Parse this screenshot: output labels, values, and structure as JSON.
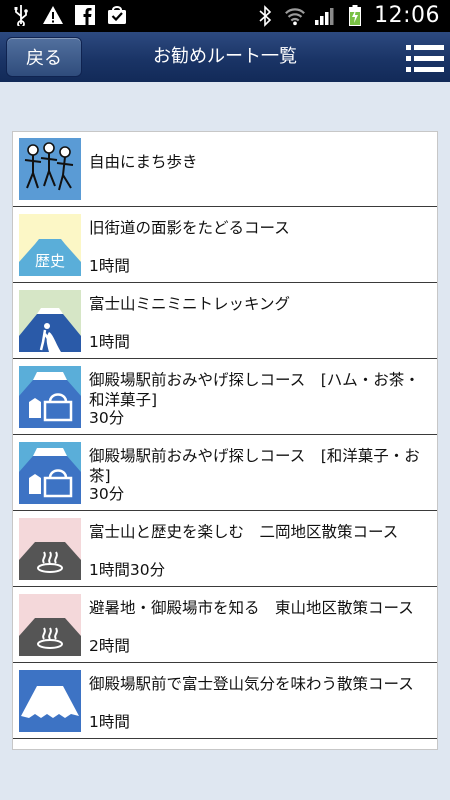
{
  "status_bar": {
    "time": "12:06",
    "icons": [
      "usb-icon",
      "warning-icon",
      "facebook-icon",
      "shopping-bag-icon",
      "bluetooth-icon",
      "wifi-icon",
      "signal-icon",
      "battery-charging-icon"
    ]
  },
  "header": {
    "back_label": "戻る",
    "title": "お勧めルート一覧",
    "menu_icon": "hamburger-menu-icon"
  },
  "routes": [
    {
      "title": "自由にまち歩き",
      "duration": "",
      "thumb": "walking-people-icon"
    },
    {
      "title": "旧街道の面影をたどるコース",
      "duration": "1時間",
      "thumb": "history-mountain-icon",
      "thumb_label": "歴史"
    },
    {
      "title": "富士山ミニミニトレッキング",
      "duration": "1時間",
      "thumb": "trekking-mountain-icon"
    },
    {
      "title": "御殿場駅前おみやげ探しコース　[ハム・お茶・和洋菓子]",
      "duration": "30分",
      "thumb": "souvenir-mountain-icon"
    },
    {
      "title": "御殿場駅前おみやげ探しコース　[和洋菓子・お茶]",
      "duration": "30分",
      "thumb": "souvenir-mountain-icon"
    },
    {
      "title": "富士山と歴史を楽しむ　二岡地区散策コース",
      "duration": "1時間30分",
      "thumb": "onsen-mountain-icon"
    },
    {
      "title": "避暑地・御殿場市を知る　東山地区散策コース",
      "duration": "2時間",
      "thumb": "onsen-mountain-icon"
    },
    {
      "title": "御殿場駅前で富士登山気分を味わう散策コース",
      "duration": "1時間",
      "thumb": "fuji-mountain-icon"
    }
  ],
  "colors": {
    "header": "#1a3466",
    "background": "#dfe7f1",
    "thumb_sky_blue": "#5aaed9",
    "thumb_yellow": "#fcf7c6",
    "thumb_green": "#d6e6c6",
    "thumb_pink": "#f4d8da"
  }
}
